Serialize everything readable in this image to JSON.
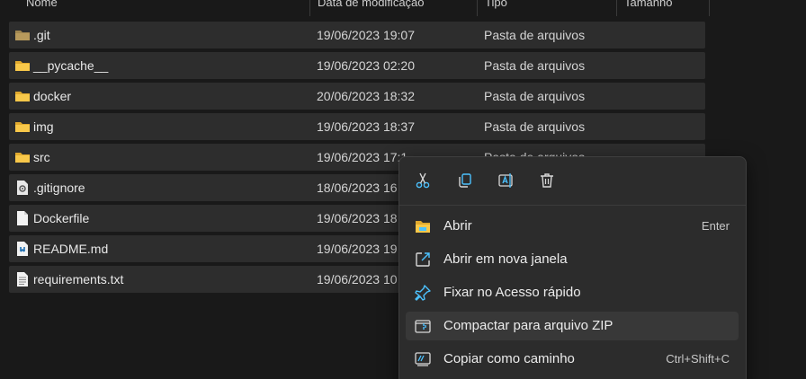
{
  "columns": {
    "name": "Nome",
    "date": "Data de modificação",
    "type": "Tipo",
    "size": "Tamanho"
  },
  "files": [
    {
      "name": ".git",
      "date": "19/06/2023 19:07",
      "type": "Pasta de arquivos",
      "icon": "folder-dim-icon"
    },
    {
      "name": "__pycache__",
      "date": "19/06/2023 02:20",
      "type": "Pasta de arquivos",
      "icon": "folder-icon"
    },
    {
      "name": "docker",
      "date": "20/06/2023 18:32",
      "type": "Pasta de arquivos",
      "icon": "folder-icon"
    },
    {
      "name": "img",
      "date": "19/06/2023 18:37",
      "type": "Pasta de arquivos",
      "icon": "folder-icon"
    },
    {
      "name": "src",
      "date": "19/06/2023 17:1",
      "type": "Pasta de arquivos",
      "icon": "folder-icon"
    },
    {
      "name": ".gitignore",
      "date": "18/06/2023 16",
      "type": "",
      "icon": "settings-file-icon"
    },
    {
      "name": "Dockerfile",
      "date": "19/06/2023 18",
      "type": "",
      "icon": "file-icon"
    },
    {
      "name": "README.md",
      "date": "19/06/2023 19",
      "type": "",
      "icon": "markdown-file-icon"
    },
    {
      "name": "requirements.txt",
      "date": "19/06/2023 10",
      "type": "",
      "icon": "text-file-icon"
    }
  ],
  "context_menu": {
    "quick_actions": [
      "cut-icon",
      "copy-icon",
      "rename-icon",
      "delete-icon"
    ],
    "items": [
      {
        "label": "Abrir",
        "shortcut": "Enter",
        "icon": "open-folder-icon"
      },
      {
        "label": "Abrir em nova janela",
        "shortcut": "",
        "icon": "open-new-window-icon"
      },
      {
        "label": "Fixar no Acesso rápido",
        "shortcut": "",
        "icon": "pin-icon"
      },
      {
        "label": "Compactar para arquivo ZIP",
        "shortcut": "",
        "icon": "zip-icon"
      },
      {
        "label": "Copiar como caminho",
        "shortcut": "Ctrl+Shift+C",
        "icon": "copy-path-icon"
      }
    ]
  },
  "colors": {
    "background": "#191919",
    "row": "#2d2d2d",
    "menu": "#2c2c2c",
    "accent": "#4cc2ff",
    "folder": "#f8c84a"
  }
}
